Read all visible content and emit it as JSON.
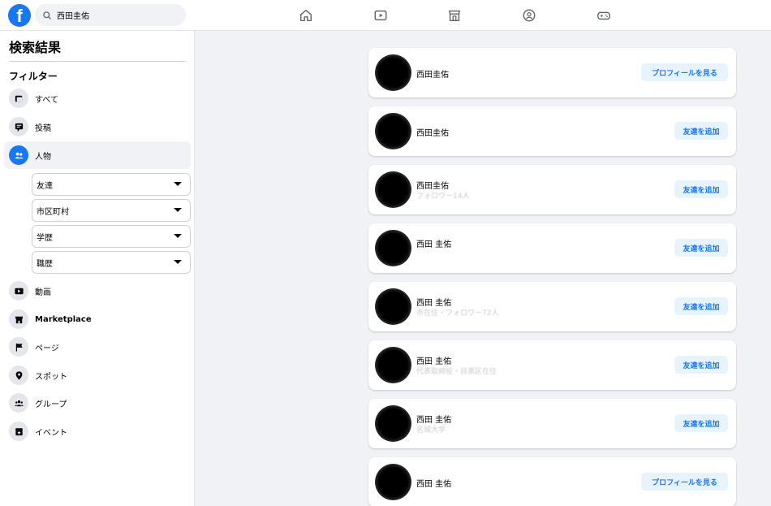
{
  "header": {
    "logo_letter": "f",
    "search": {
      "value": "西田圭佑",
      "icon": "search-icon"
    },
    "nav_icons": [
      "home-icon",
      "video-icon",
      "marketplace-icon",
      "groups-icon",
      "gaming-icon"
    ]
  },
  "sidebar": {
    "title": "検索結果",
    "filter_heading": "フィルター",
    "items": [
      {
        "label": "すべて",
        "icon": "all-results-icon"
      },
      {
        "label": "投稿",
        "icon": "posts-icon"
      },
      {
        "label": "人物",
        "icon": "people-icon",
        "active": true
      },
      {
        "label": "動画",
        "icon": "video-icon"
      },
      {
        "label": "Marketplace",
        "icon": "marketplace-icon"
      },
      {
        "label": "ページ",
        "icon": "pages-flag-icon"
      },
      {
        "label": "スポット",
        "icon": "location-pin-icon"
      },
      {
        "label": "グループ",
        "icon": "groups-icon"
      },
      {
        "label": "イベント",
        "icon": "events-icon"
      }
    ],
    "people_filters": [
      "友達",
      "市区町村",
      "学歴",
      "職歴"
    ]
  },
  "results": [
    {
      "name": "西田圭佑",
      "subtitle": "",
      "action": "プロフィールを見る"
    },
    {
      "name": "西田圭佑",
      "subtitle": "",
      "action": "友達を追加"
    },
    {
      "name": "西田圭佑",
      "subtitle": "フォロワー14人",
      "action": "友達を追加"
    },
    {
      "name": "西田 圭佑",
      "subtitle": "",
      "action": "友達を追加"
    },
    {
      "name": "西田 圭佑",
      "subtitle": "市在住・フォロワー72人",
      "action": "友達を追加"
    },
    {
      "name": "西田 圭佑",
      "subtitle": "代表取締役・目黒区在住",
      "action": "友達を追加"
    },
    {
      "name": "西田 圭佑",
      "subtitle": "名城大学",
      "action": "友達を追加"
    },
    {
      "name": "西田 圭佑",
      "subtitle": "",
      "action": "プロフィールを見る"
    }
  ],
  "colors": {
    "brand": "#1877f2",
    "page_bg": "#f0f2f5",
    "button_bg": "#e7f3ff"
  }
}
